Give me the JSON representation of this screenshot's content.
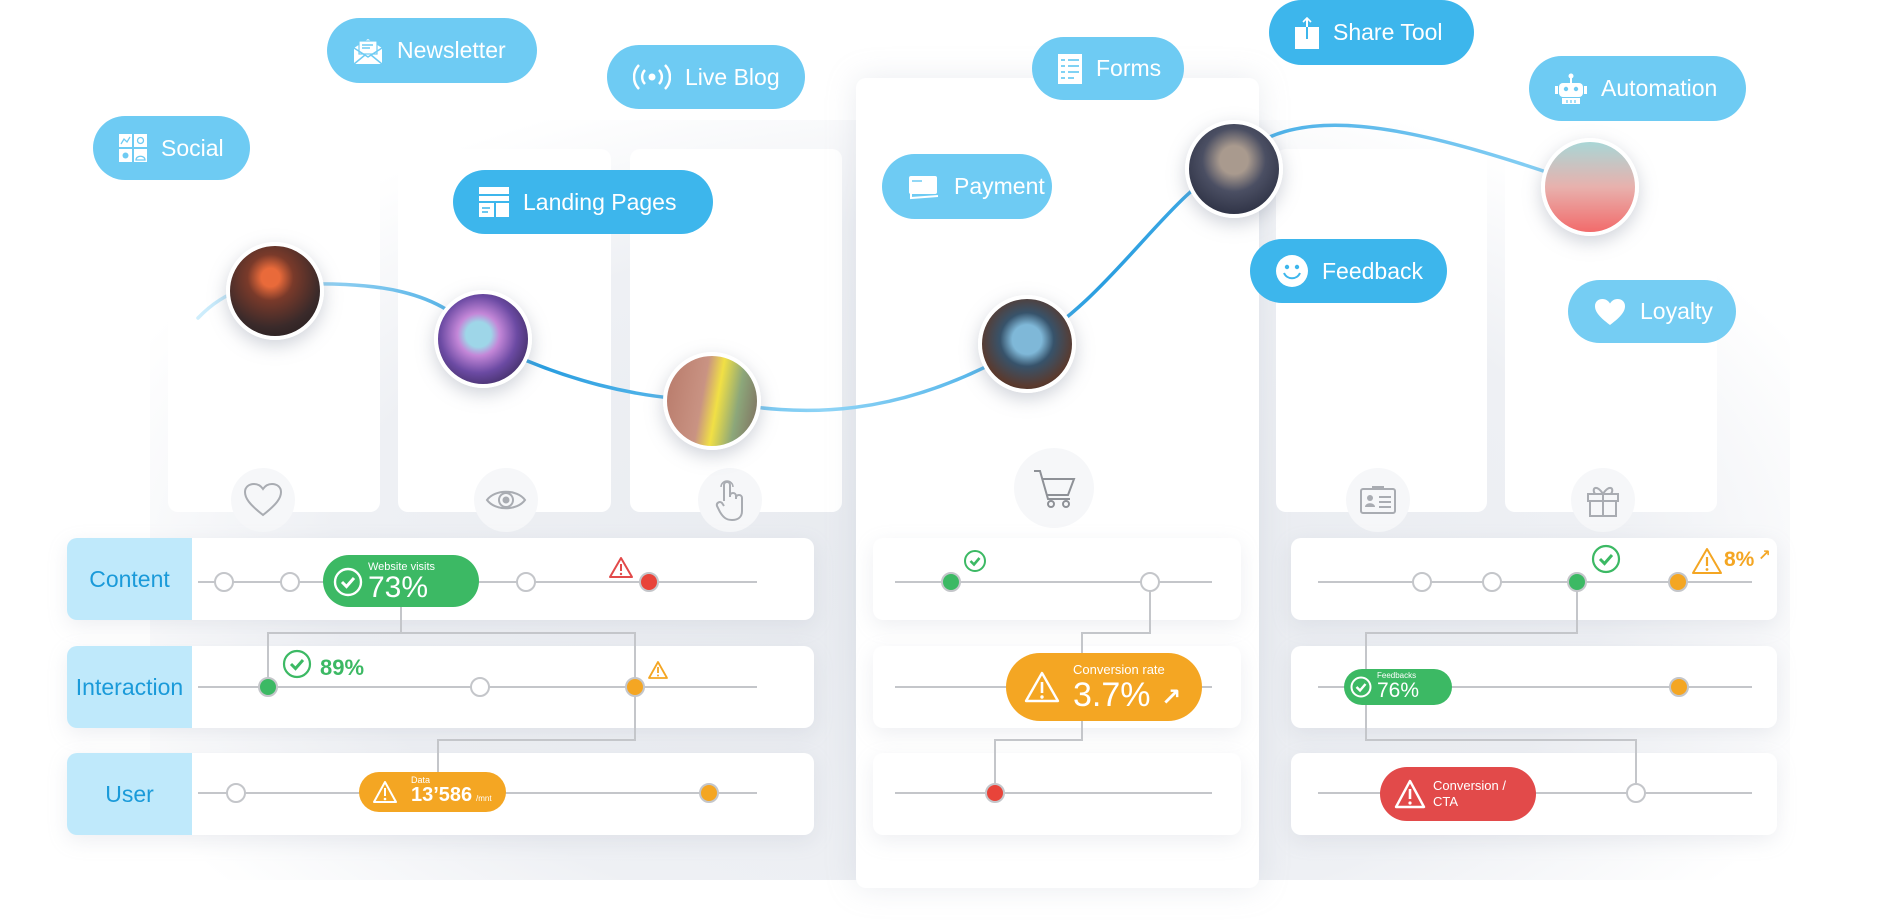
{
  "colors": {
    "pill_light": "#6ecbf3",
    "pill_dark": "#3db6ec",
    "label_bg": "#bfe9fb",
    "label_text": "#1a9ad9",
    "green": "#3cb964",
    "orange": "#f4a623",
    "red": "#e24a4a",
    "curve": "#2a9ee0"
  },
  "channels": [
    {
      "label": "Social",
      "icon": "social-grid-icon"
    },
    {
      "label": "Newsletter",
      "icon": "envelope-icon"
    },
    {
      "label": "Live Blog",
      "icon": "broadcast-icon"
    },
    {
      "label": "Landing Pages",
      "icon": "webpage-layout-icon"
    },
    {
      "label": "Payment",
      "icon": "credit-card-icon"
    },
    {
      "label": "Forms",
      "icon": "form-list-icon"
    },
    {
      "label": "Share Tool",
      "icon": "share-upload-icon"
    },
    {
      "label": "Automation",
      "icon": "robot-icon"
    },
    {
      "label": "Feedback",
      "icon": "smiley-icon"
    },
    {
      "label": "Loyalty",
      "icon": "heart-icon"
    }
  ],
  "stage_icons": [
    "heart-outline-icon",
    "eye-icon",
    "pointer-hand-icon",
    "shopping-cart-icon",
    "id-card-icon",
    "gift-icon"
  ],
  "rows": {
    "labels": [
      "Content",
      "Interaction",
      "User"
    ]
  },
  "metrics": {
    "website_visits": {
      "label": "Website visits",
      "value": "73%",
      "status": "success"
    },
    "interaction_rate": {
      "value": "89%",
      "status": "success"
    },
    "data": {
      "label": "Data",
      "value": "13’586",
      "unit": "/mnt",
      "status": "warning"
    },
    "conversion_rate": {
      "label": "Conversion rate",
      "value": "3.7%",
      "trend": "↗",
      "status": "warning"
    },
    "right_content": {
      "value": "8%",
      "trend": "↗",
      "status": "warning"
    },
    "feedbacks": {
      "label": "Feedbacks",
      "value": "76%",
      "status": "success"
    },
    "conversion_cta": {
      "label_line1": "Conversion /",
      "label_line2": "CTA",
      "status": "error"
    }
  }
}
